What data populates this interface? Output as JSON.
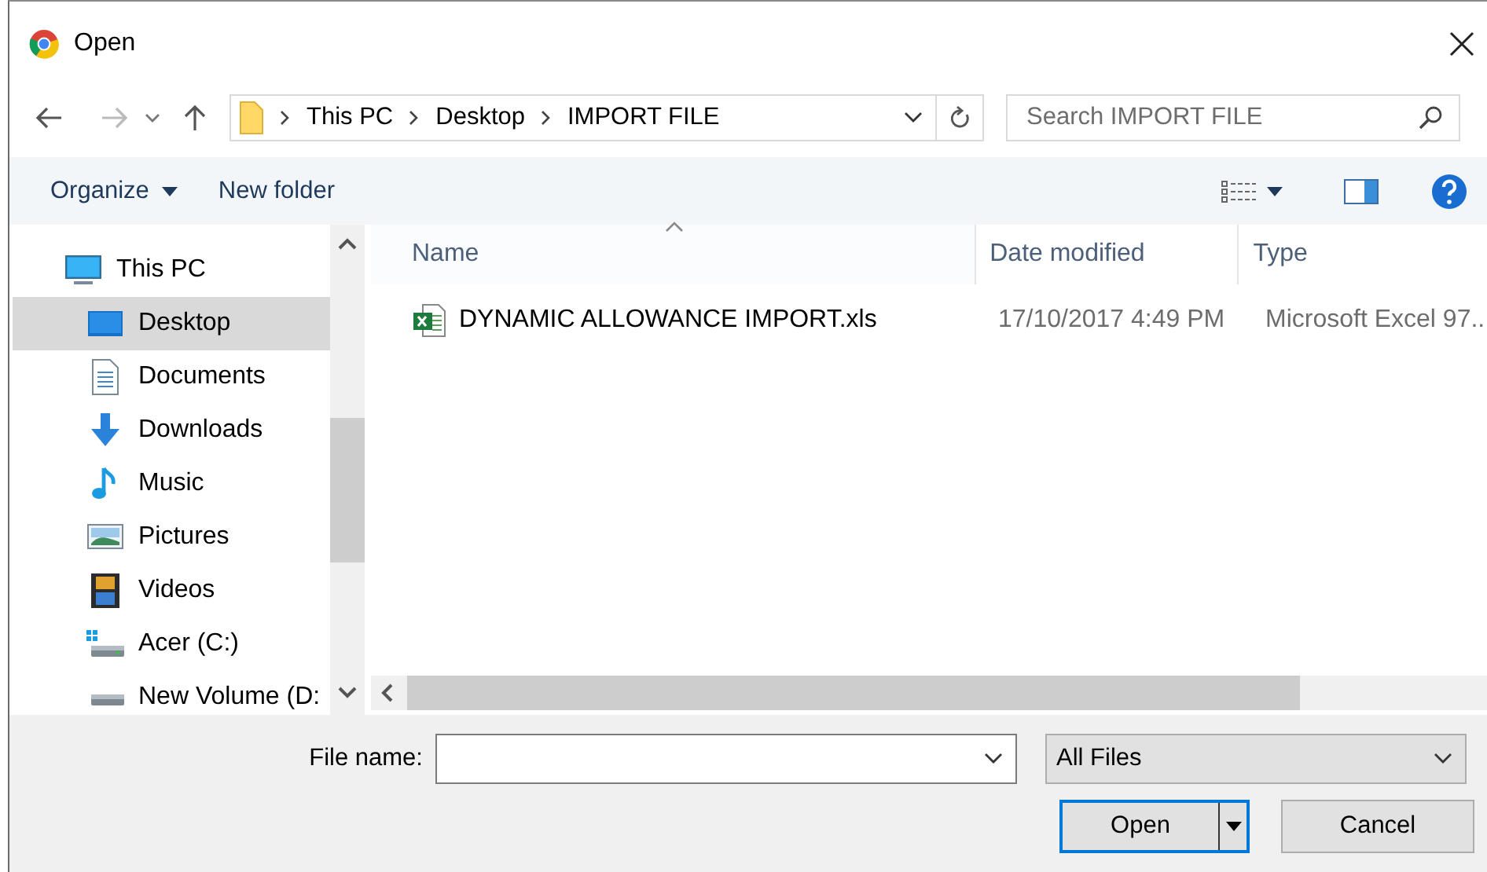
{
  "window": {
    "title": "Open"
  },
  "nav": {
    "path": [
      {
        "label": "This PC"
      },
      {
        "label": "Desktop"
      },
      {
        "label": "IMPORT FILE"
      }
    ],
    "search": {
      "placeholder": "Search IMPORT FILE"
    }
  },
  "toolbar": {
    "buttons": [
      {
        "label": "Organize",
        "kind": "menu"
      },
      {
        "label": "New folder",
        "kind": "plain"
      }
    ]
  },
  "sidebar": {
    "items": [
      {
        "label": "This PC",
        "selected": false,
        "children": [
          {
            "label": "Desktop",
            "selected": true
          },
          {
            "label": "Documents",
            "selected": false
          },
          {
            "label": "Downloads",
            "selected": false
          },
          {
            "label": "Music",
            "selected": false
          },
          {
            "label": "Pictures",
            "selected": false
          },
          {
            "label": "Videos",
            "selected": false
          },
          {
            "label": "Acer (C:)",
            "selected": false
          },
          {
            "label": "New Volume (D:",
            "selected": false
          }
        ]
      }
    ]
  },
  "table": {
    "columns": [
      {
        "label": "Name",
        "sorted": true
      },
      {
        "label": "Date modified",
        "sorted": false
      },
      {
        "label": "Type",
        "sorted": false
      }
    ],
    "rows": [
      {
        "name": "DYNAMIC ALLOWANCE IMPORT.xls",
        "date_modified": "17/10/2017 4:49 PM",
        "type": "Microsoft Excel 97..",
        "selected": false
      }
    ]
  },
  "footer": {
    "file_name": {
      "label": "File name:"
    },
    "file_type": {
      "value": "All Files"
    },
    "buttons": [
      {
        "label": "Open",
        "kind": "split",
        "default": true
      },
      {
        "label": "Cancel",
        "kind": "plain",
        "default": false
      }
    ]
  }
}
